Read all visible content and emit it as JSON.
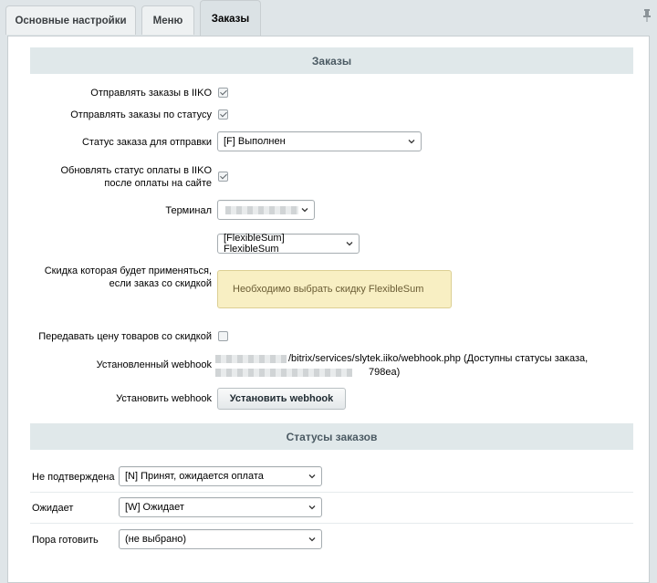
{
  "tabs": [
    {
      "label": "Основные настройки"
    },
    {
      "label": "Меню"
    },
    {
      "label": "Заказы"
    }
  ],
  "orders_section": {
    "title": "Заказы",
    "send_orders_label": "Отправлять заказы в IIKO",
    "send_orders_checked": true,
    "send_by_status_label": "Отправлять заказы по статусу",
    "send_by_status_checked": true,
    "send_status_label": "Статус заказа для отправки",
    "send_status_value": "[F] Выполнен",
    "update_payment_label_line1": "Обновлять статус оплаты в IIKO",
    "update_payment_label_line2": "после оплаты на сайте",
    "update_payment_checked": true,
    "terminal_label": "Терминал",
    "terminal_value": "",
    "discount_select_value": "[FlexibleSum] FlexibleSum",
    "discount_label_line1": "Скидка которая будет применяться,",
    "discount_label_line2": "если заказ со скидкой",
    "discount_notice": "Необходимо выбрать скидку FlexibleSum",
    "pass_price_label": "Передавать цену товаров со скидкой",
    "pass_price_checked": false,
    "webhook_label": "Установленный webhook",
    "webhook_text_line1": "/bitrix/services/slytek.iiko/webhook.php (Доступны статусы заказа,",
    "webhook_text_line2": "798ea)",
    "install_webhook_label": "Установить webhook",
    "install_webhook_button": "Установить webhook"
  },
  "statuses_section": {
    "title": "Статусы заказов",
    "rows": [
      {
        "label": "Не подтверждена",
        "value": "[N] Принят, ожидается оплата"
      },
      {
        "label": "Ожидает",
        "value": "[W] Ожидает"
      },
      {
        "label": "Пора готовить",
        "value": "(не выбрано)"
      }
    ]
  }
}
